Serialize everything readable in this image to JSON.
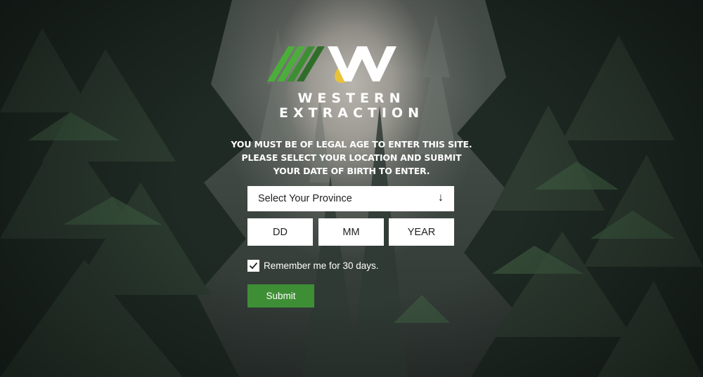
{
  "brand": {
    "line1": "WESTERN",
    "line2": "EXTRACTION",
    "colors": {
      "green_light": "#4cae3a",
      "green_dark": "#2f6e28",
      "drop": "#e8c23a",
      "white": "#ffffff"
    }
  },
  "notice": {
    "line1": "YOU MUST BE OF LEGAL AGE TO ENTER THIS SITE.",
    "line2": "PLEASE SELECT YOUR LOCATION AND SUBMIT",
    "line3": "YOUR DATE OF BIRTH TO ENTER."
  },
  "province_select": {
    "selected": "Select Your Province",
    "arrow": "↓"
  },
  "dob": {
    "day_placeholder": "DD",
    "month_placeholder": "MM",
    "year_placeholder": "YEAR"
  },
  "remember": {
    "checked": true,
    "check_glyph": "✓",
    "label": "Remember me for 30 days."
  },
  "submit": {
    "label": "Submit",
    "color": "#3e8e35"
  }
}
